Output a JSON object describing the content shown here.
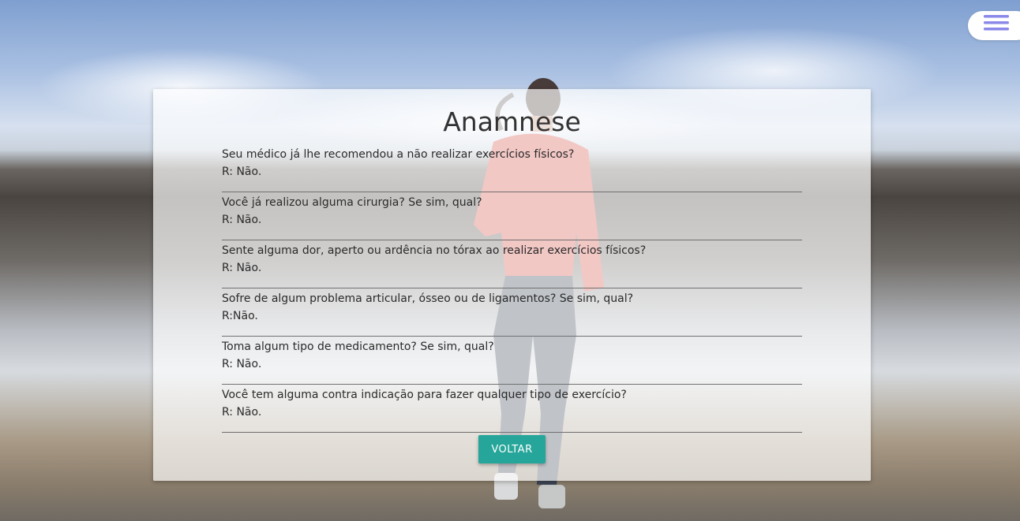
{
  "nav": {
    "menu_icon": "hamburger-menu-icon",
    "menu_color": "#8a88e8"
  },
  "card": {
    "title": "Anamnese",
    "items": [
      {
        "question": "Seu médico já lhe recomendou a não realizar exercícios físicos?",
        "answer": "R: Não."
      },
      {
        "question": "Você já realizou alguma cirurgia? Se sim, qual?",
        "answer": "R: Não."
      },
      {
        "question": "Sente alguma dor, aperto ou ardência no tórax ao realizar exercícios físicos?",
        "answer": "R: Não."
      },
      {
        "question": "Sofre de algum problema articular, ósseo ou de ligamentos? Se sim, qual?",
        "answer": "R:Não."
      },
      {
        "question": "Toma algum tipo de medicamento? Se sim, qual?",
        "answer": "R: Não."
      },
      {
        "question": "Você tem alguma contra indicação para fazer qualquer tipo de exercício?",
        "answer": "R: Não."
      }
    ],
    "back_label": "VOLTAR",
    "accent_color": "#26a69a"
  }
}
